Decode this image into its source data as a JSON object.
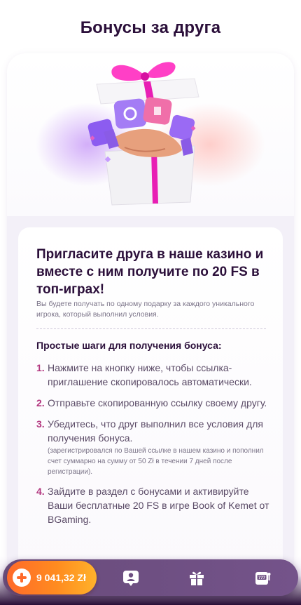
{
  "page": {
    "title": "Бонусы за друга"
  },
  "promo": {
    "headline": "Пригласите друга в наше казино и вместе с ним получите по 20 FS в топ-играх!",
    "subtext": "Вы будете получать по одному подарку за каждого уникального игрока, который выполнил условия."
  },
  "steps_section": {
    "title": "Простые шаги для получения бонуса:",
    "steps": [
      {
        "num": "1.",
        "text": "Нажмите на кнопку ниже, чтобы ссылка-приглашение скопировалось автоматически.",
        "note": ""
      },
      {
        "num": "2.",
        "text": "Отправьте скопированную ссылку своему другу.",
        "note": ""
      },
      {
        "num": "3.",
        "text": "Убедитесь, что друг выполнил все условия для получения бонуса.",
        "note": "(зарегистрировался по Вашей ссылке в нашем казино и пополнил счет суммарно на сумму от 50 Zł в течении 7 дней после регистрации)."
      },
      {
        "num": "4.",
        "text": "Зайдите в раздел с бонусами и активируйте Ваши бесплатные 20 FS в игре Book of Kemet от BGaming.",
        "note": ""
      }
    ]
  },
  "bottom_nav": {
    "balance": "9 041,32 Zł",
    "items": [
      {
        "icon": "profile-icon"
      },
      {
        "icon": "gift-icon"
      },
      {
        "icon": "slot-machine-icon"
      }
    ]
  },
  "colors": {
    "accent_orange": "#ff7a22",
    "accent_pink": "#b2367f",
    "title_dark": "#2b0f3a",
    "nav_purple": "#6e4f82"
  }
}
